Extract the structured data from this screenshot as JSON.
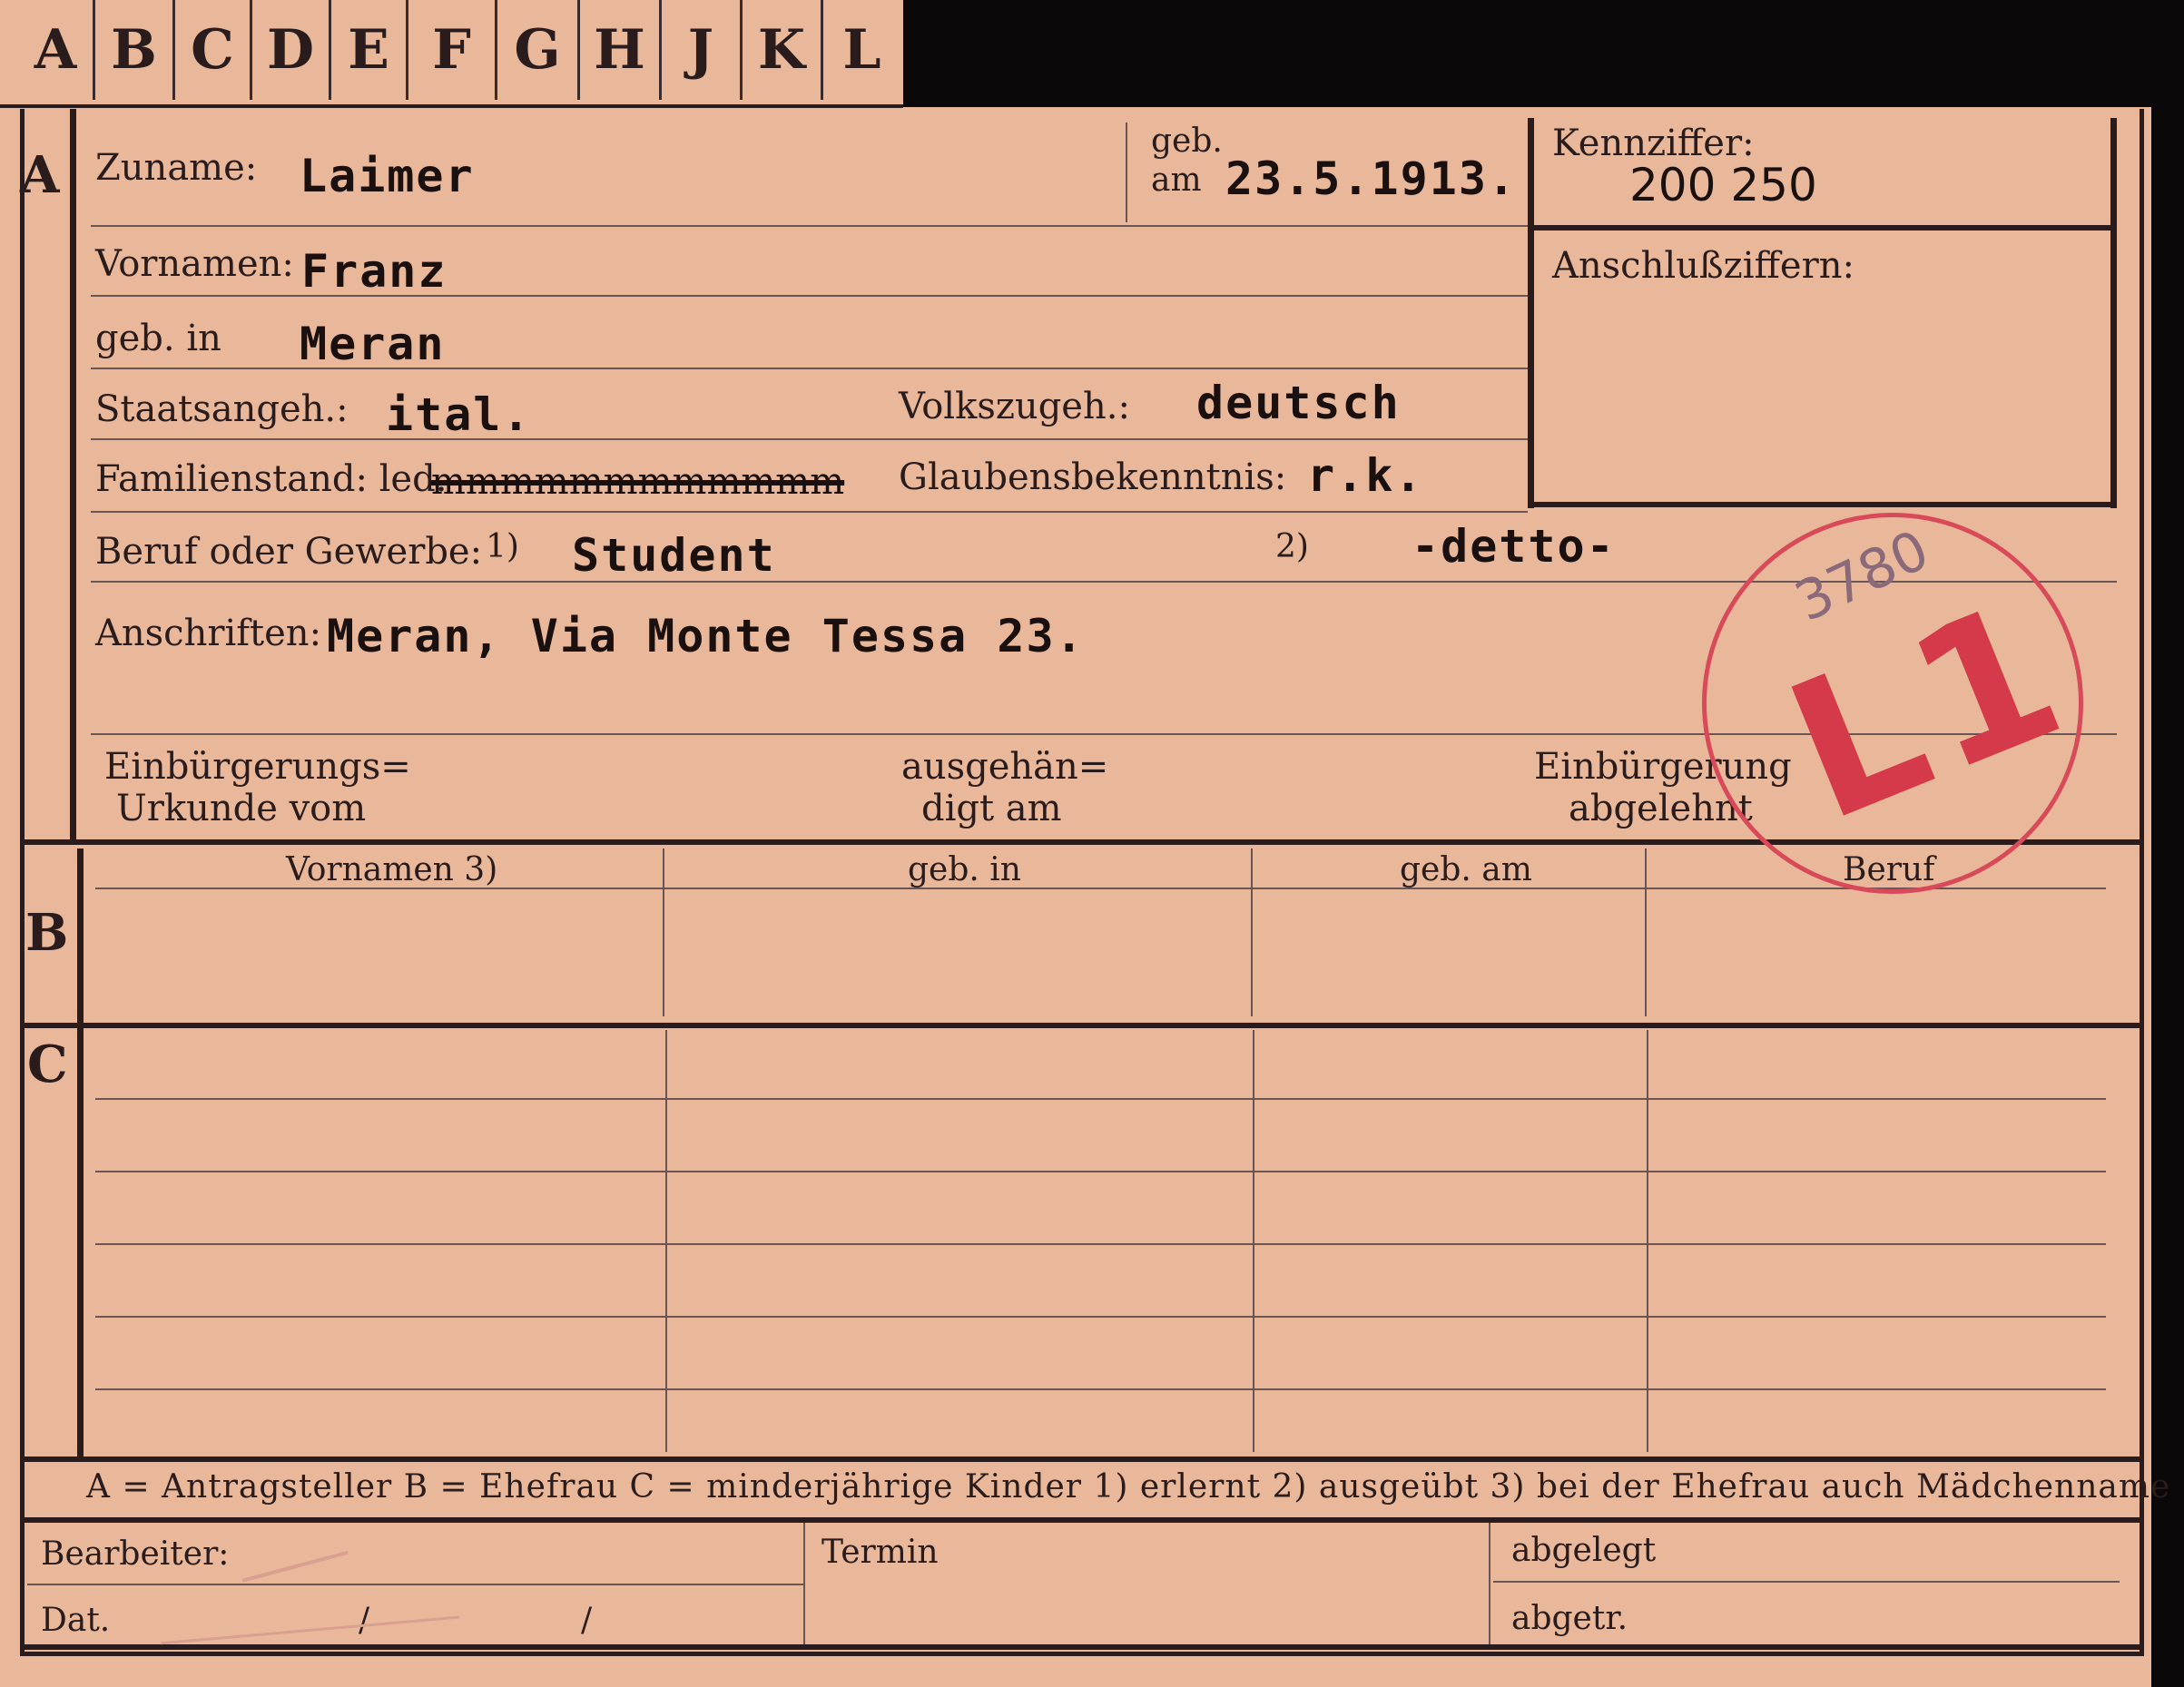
{
  "tabs": [
    "A",
    "B",
    "C",
    "D",
    "E",
    "F",
    "G",
    "H",
    "J",
    "K",
    "L"
  ],
  "section_letters": {
    "a": "A",
    "b": "B",
    "c": "C"
  },
  "fields": {
    "zuname_label": "Zuname:",
    "zuname_value": "Laimer",
    "geb_label_top": "geb.",
    "geb_label_am": "am",
    "geb_value": "23.5.1913.",
    "kennziffer_label": "Kennziffer:",
    "kennziffer_value": "200 250",
    "anschluss_label": "Anschlußziffern:",
    "vornamen_label": "Vornamen:",
    "vornamen_value": "Franz",
    "gebin_label": "geb. in",
    "gebin_value": "Meran",
    "staats_label": "Staatsangeh.:",
    "staats_value": "ital.",
    "volks_label": "Volkszugeh.:",
    "volks_value": "deutsch",
    "familien_label": "Familienstand: led.",
    "familien_struck": "mmmmmmmmmmmm",
    "glauben_label": "Glaubensbekenntnis:",
    "glauben_value": "r.k.",
    "beruf_label": "Beruf oder Gewerbe:",
    "beruf_note1": "1)",
    "beruf_value1": "Student",
    "beruf_note2": "2)",
    "beruf_value2": "-detto-",
    "anschrift_label": "Anschriften:",
    "anschrift_value": "Meran, Via Monte Tessa 23.",
    "einb_urkunde_1": "Einbürgerungs=",
    "einb_urkunde_2": "Urkunde vom",
    "ausgeh_1": "ausgehän=",
    "ausgeh_2": "digt am",
    "einb_abgelehnt_1": "Einbürgerung",
    "einb_abgelehnt_2": "abgelehnt"
  },
  "b_columns": [
    "Vornamen 3)",
    "geb. in",
    "geb. am",
    "Beruf"
  ],
  "legend": "A = Antragsteller   B = Ehefrau   C = minderjährige Kinder   1) erlernt   2) ausgeübt   3) bei der Ehefrau auch Mädchenname",
  "footer": {
    "bearbeiter": "Bearbeiter:",
    "termin": "Termin",
    "abgelegt": "abgelegt",
    "dat": "Dat.",
    "slash1": "/",
    "slash2": "/",
    "abgetr": "abgetr."
  },
  "stamp": {
    "text": "L1",
    "number": "3780",
    "color": "#d43a4a"
  },
  "colors": {
    "paper": "#e9b89a",
    "ink": "#2a1c1c",
    "stamp": "#d84a5a"
  }
}
